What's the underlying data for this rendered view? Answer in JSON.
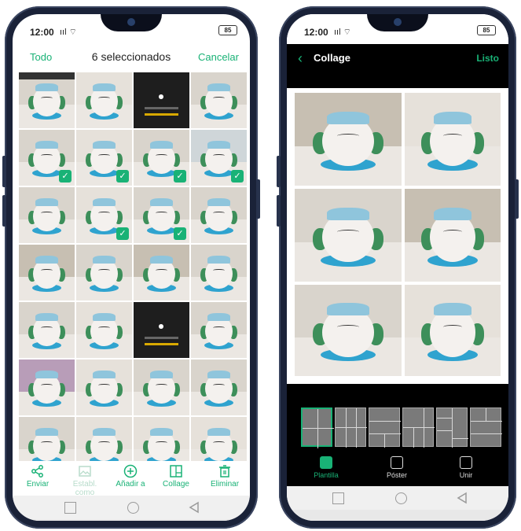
{
  "left": {
    "status": {
      "time": "12:00",
      "signal": "ııl ⌔",
      "battery": "85"
    },
    "topbar": {
      "left": "Todo",
      "title": "6 seleccionados",
      "right": "Cancelar"
    },
    "toolbar": {
      "share": "Enviar",
      "set_as": "Establ. como",
      "add_to": "Añadir a",
      "collage": "Collage",
      "delete": "Eliminar"
    }
  },
  "right": {
    "status": {
      "time": "12:00",
      "signal": "ııl ⌔",
      "battery": "85"
    },
    "header": {
      "back": "‹",
      "title": "Collage",
      "done": "Listo"
    },
    "tabs": {
      "template": "Plantilla",
      "poster": "Póster",
      "join": "Unir"
    }
  },
  "colors": {
    "accent": "#19b276"
  }
}
